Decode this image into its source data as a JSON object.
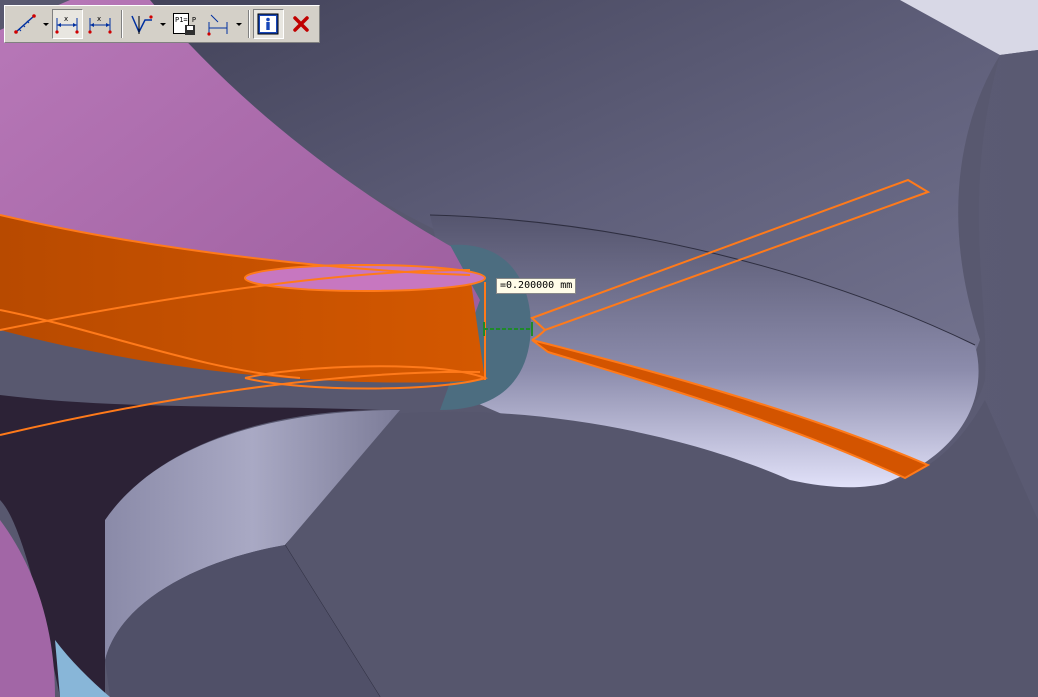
{
  "toolbar": {
    "buttons": [
      {
        "name": "measure-icon",
        "has_dropdown": true
      },
      {
        "name": "dimension-horizontal-icon",
        "active": true
      },
      {
        "name": "dimension-aligned-icon"
      },
      {
        "name": "curve-analysis-icon",
        "has_dropdown": true
      },
      {
        "name": "point-compare-icon",
        "label": "P1= P2="
      },
      {
        "name": "dimension-offset-icon",
        "has_dropdown": true
      },
      {
        "name": "info-icon",
        "active": true
      },
      {
        "name": "close-icon"
      }
    ]
  },
  "measurement": {
    "value": "=0.200000 mm"
  },
  "colors": {
    "background_face": "#5a5a72",
    "pink_surface": "#b070b0",
    "highlight_orange": "#d35400",
    "dimension_green": "#1f8a2a",
    "toolbar_bg": "#d4d0c8"
  }
}
